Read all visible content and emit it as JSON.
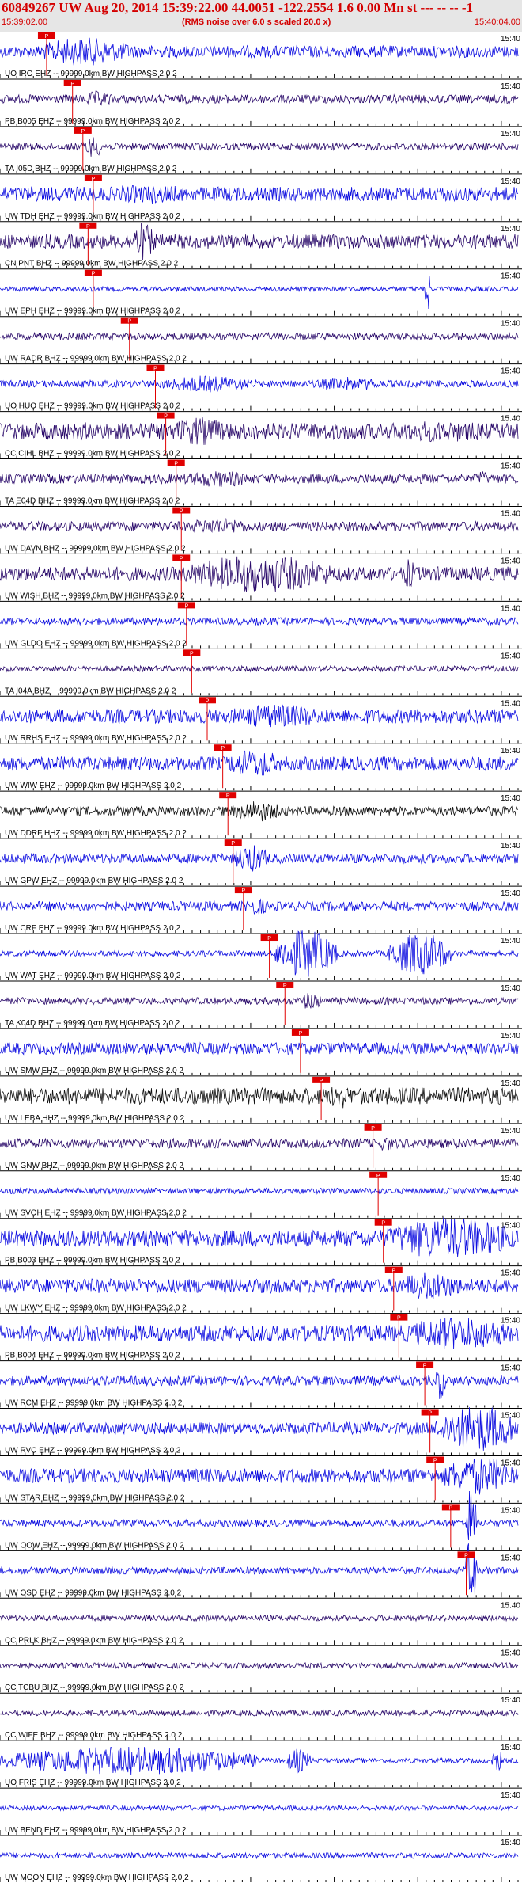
{
  "header": {
    "title": "60849267 UW Aug 20, 2014 15:39:22.00   44.0051 -122.2554  1.6 0.00 Mn st --- -- --  -1",
    "start_time": "15:39:02.00",
    "note": "(RMS noise over 6.0 s scaled 20.0 x)",
    "end_time": "15:40:04.00"
  },
  "chart_data": {
    "type": "line",
    "x_axis": {
      "start": "15:39:02.00",
      "end": "15:40:04.00",
      "unit": "time"
    },
    "tick_right_label": "15:40",
    "pick_marker_label": "P",
    "colors": {
      "blue": "#1010e0",
      "purple": "#2a0a6a",
      "black": "#111111",
      "pick": "#e00000",
      "text": "#000000"
    },
    "traces": [
      {
        "label": "UO IRO EHZ -- 99999.0km BW  HIGHPASS  2.0  2",
        "color": "blue",
        "pick": 0.09,
        "amp": 0.25,
        "bursts": [
          [
            0.07,
            0.25,
            0.6
          ],
          [
            0.15,
            0.28,
            0.4
          ]
        ]
      },
      {
        "label": "PB B005 EHZ -- 99999.0km BW  HIGHPASS  2.0  2",
        "color": "purple",
        "pick": 0.14,
        "amp": 0.18,
        "bursts": [
          [
            0.16,
            0.22,
            0.35
          ]
        ]
      },
      {
        "label": "TA I05D BHZ -- 99999.0km BW  HIGHPASS  2.0  2",
        "color": "purple",
        "pick": 0.16,
        "amp": 0.15,
        "bursts": [
          [
            0.16,
            0.2,
            0.45
          ]
        ]
      },
      {
        "label": "UW TDH EHZ -- 99999.0km BW  HIGHPASS  2.0  2",
        "color": "blue",
        "pick": 0.18,
        "amp": 0.3,
        "bursts": [
          [
            0.18,
            0.4,
            0.4
          ]
        ]
      },
      {
        "label": "CN PNT BHZ -- 99999.0km BW  HIGHPASS  2.0  2",
        "color": "purple",
        "pick": 0.17,
        "amp": 0.3,
        "bursts": [
          [
            0.25,
            0.3,
            0.8
          ]
        ]
      },
      {
        "label": "UW EPH EHZ -- 99999.0km BW  HIGHPASS  2.0  2",
        "color": "blue",
        "pick": 0.18,
        "amp": 0.1,
        "bursts": [
          [
            0.82,
            0.83,
            1.2
          ]
        ]
      },
      {
        "label": "UW RADR BHZ -- 99999.0km BW  HIGHPASS  2.0  2",
        "color": "purple",
        "pick": 0.25,
        "amp": 0.15,
        "bursts": []
      },
      {
        "label": "UO HUO EHZ -- 99999.0km BW  HIGHPASS  2.0  2",
        "color": "blue",
        "pick": 0.3,
        "amp": 0.15,
        "bursts": [
          [
            0.3,
            0.5,
            0.35
          ],
          [
            0.6,
            0.75,
            0.3
          ]
        ]
      },
      {
        "label": "CC CIHL BHZ -- 99999.0km BW  HIGHPASS  2.0  2",
        "color": "purple",
        "pick": 0.32,
        "amp": 0.35,
        "bursts": [
          [
            0.32,
            0.45,
            0.6
          ],
          [
            0.7,
            1.0,
            0.45
          ]
        ]
      },
      {
        "label": "TA E04D BHZ -- 99999.0km BW  HIGHPASS  2.0  2",
        "color": "purple",
        "pick": 0.34,
        "amp": 0.2,
        "bursts": [
          [
            0.34,
            0.5,
            0.35
          ],
          [
            0.92,
            0.94,
            0.4
          ]
        ]
      },
      {
        "label": "UW DAVN BHZ -- 99999.0km BW  HIGHPASS  2.0  2",
        "color": "purple",
        "pick": 0.35,
        "amp": 0.2,
        "bursts": [
          [
            0.35,
            0.5,
            0.35
          ]
        ]
      },
      {
        "label": "UW WISH BHZ -- 99999.0km BW  HIGHPASS  2.0  2",
        "color": "purple",
        "pick": 0.35,
        "amp": 0.3,
        "bursts": [
          [
            0.35,
            0.65,
            0.8
          ],
          [
            0.78,
            0.8,
            0.7
          ]
        ]
      },
      {
        "label": "UW GLDO EHZ -- 99999.0km BW  HIGHPASS  2.0  2",
        "color": "blue",
        "pick": 0.36,
        "amp": 0.15,
        "bursts": []
      },
      {
        "label": "TA I04A BHZ -- 99999.0km BW  HIGHPASS  2.0  2",
        "color": "purple",
        "pick": 0.37,
        "amp": 0.12,
        "bursts": []
      },
      {
        "label": "UW RRHS EHZ -- 99999.0km BW  HIGHPASS  2.0  2",
        "color": "blue",
        "pick": 0.4,
        "amp": 0.3,
        "bursts": [
          [
            0.42,
            0.65,
            0.5
          ]
        ]
      },
      {
        "label": "UW WIW EHZ -- 99999.0km BW  HIGHPASS  2.0  2",
        "color": "blue",
        "pick": 0.43,
        "amp": 0.3,
        "bursts": [
          [
            0.43,
            0.55,
            0.6
          ]
        ]
      },
      {
        "label": "UW DDRF HHZ -- 99999.0km BW  HIGHPASS  2.0  2",
        "color": "black",
        "pick": 0.44,
        "amp": 0.2,
        "bursts": [
          [
            0.44,
            0.55,
            0.45
          ]
        ]
      },
      {
        "label": "UW GPW EHZ -- 99999.0km BW  HIGHPASS  2.0  2",
        "color": "blue",
        "pick": 0.45,
        "amp": 0.2,
        "bursts": [
          [
            0.45,
            0.52,
            0.6
          ]
        ]
      },
      {
        "label": "UW CRF EHZ -- 99999.0km BW  HIGHPASS  2.0  2",
        "color": "blue",
        "pick": 0.47,
        "amp": 0.2,
        "bursts": [
          [
            0.47,
            0.52,
            0.4
          ]
        ]
      },
      {
        "label": "UW WAT EHZ -- 99999.0km BW  HIGHPASS  2.0  2",
        "color": "blue",
        "pick": 0.52,
        "amp": 0.12,
        "bursts": [
          [
            0.53,
            0.65,
            1.0
          ],
          [
            0.75,
            0.87,
            0.9
          ]
        ]
      },
      {
        "label": "TA K04D BHZ -- 99999.0km BW  HIGHPASS  2.0  2",
        "color": "purple",
        "pick": 0.55,
        "amp": 0.15,
        "bursts": [
          [
            0.58,
            0.62,
            0.4
          ]
        ]
      },
      {
        "label": "UW SMW EHZ -- 99999.0km BW  HIGHPASS  2.0  2",
        "color": "blue",
        "pick": 0.58,
        "amp": 0.25,
        "bursts": []
      },
      {
        "label": "UW LEBA HHZ -- 99999.0km BW  HIGHPASS  2.0  2",
        "color": "black",
        "pick": 0.62,
        "amp": 0.35,
        "bursts": [
          [
            0.63,
            0.68,
            0.55
          ]
        ]
      },
      {
        "label": "UW GNW BHZ -- 99999.0km BW  HIGHPASS  2.0  2",
        "color": "purple",
        "pick": 0.72,
        "amp": 0.2,
        "bursts": [
          [
            0.73,
            0.76,
            0.35
          ]
        ]
      },
      {
        "label": "UW SVOH EHZ -- 99999.0km BW  HIGHPASS  2.0  2",
        "color": "blue",
        "pick": 0.73,
        "amp": 0.12,
        "bursts": []
      },
      {
        "label": "PB B003 EHZ -- 99999.0km BW  HIGHPASS  2.0  2",
        "color": "blue",
        "pick": 0.74,
        "amp": 0.35,
        "bursts": [
          [
            0.74,
            1.0,
            0.9
          ]
        ]
      },
      {
        "label": "UW LKWY EHZ -- 99999.0km BW  HIGHPASS  2.0  2",
        "color": "blue",
        "pick": 0.76,
        "amp": 0.3,
        "bursts": [
          [
            0.76,
            0.9,
            0.6
          ]
        ]
      },
      {
        "label": "PB B004 EHZ -- 99999.0km BW  HIGHPASS  2.0  2",
        "color": "blue",
        "pick": 0.77,
        "amp": 0.35,
        "bursts": [
          [
            0.77,
            1.0,
            0.7
          ]
        ]
      },
      {
        "label": "UW RCM EHZ -- 99999.0km BW  HIGHPASS  2.0  2",
        "color": "blue",
        "pick": 0.82,
        "amp": 0.2,
        "bursts": [
          [
            0.84,
            0.86,
            0.8
          ]
        ]
      },
      {
        "label": "UW RVC EHZ -- 99999.0km BW  HIGHPASS  2.0  2",
        "color": "blue",
        "pick": 0.83,
        "amp": 0.25,
        "bursts": [
          [
            0.84,
            1.0,
            1.0
          ]
        ]
      },
      {
        "label": "UW STAR EHZ -- 99999.0km BW  HIGHPASS  2.0  2",
        "color": "blue",
        "pick": 0.84,
        "amp": 0.3,
        "bursts": [
          [
            0.85,
            1.0,
            0.8
          ]
        ]
      },
      {
        "label": "UW OOW EHZ -- 99999.0km BW  HIGHPASS  2.0  2",
        "color": "blue",
        "pick": 0.87,
        "amp": 0.15,
        "bursts": [
          [
            0.9,
            0.92,
            1.6
          ]
        ]
      },
      {
        "label": "UW OSD EHZ -- 99999.0km BW  HIGHPASS  2.0  2",
        "color": "blue",
        "pick": 0.9,
        "amp": 0.15,
        "bursts": [
          [
            0.9,
            0.92,
            1.6
          ]
        ]
      },
      {
        "label": "CC PRLK BHZ -- 99999.0km BW  HIGHPASS  2.0  2",
        "color": "purple",
        "pick": null,
        "amp": 0.12,
        "bursts": []
      },
      {
        "label": "CC TCBU BHZ -- 99999.0km BW  HIGHPASS  2.0  2",
        "color": "purple",
        "pick": null,
        "amp": 0.12,
        "bursts": []
      },
      {
        "label": "CC WIFE BHZ -- 99999.0km BW  HIGHPASS  2.0  2",
        "color": "purple",
        "pick": null,
        "amp": 0.12,
        "bursts": []
      },
      {
        "label": "UO FRIS EHZ -- 99999.0km BW  HIGHPASS  2.0  2",
        "color": "blue",
        "pick": null,
        "amp": 0.1,
        "bursts": [
          [
            0.0,
            0.5,
            0.6
          ],
          [
            0.55,
            0.6,
            0.5
          ],
          [
            0.95,
            0.97,
            0.5
          ]
        ]
      },
      {
        "label": "UW BEND EHZ -- 99999.0km BW  HIGHPASS  2.0  2",
        "color": "blue",
        "pick": null,
        "amp": 0.1,
        "bursts": []
      },
      {
        "label": "UW MOON EHZ -- 99999.0km BW  HIGHPASS  2.0  2",
        "color": "blue",
        "pick": null,
        "amp": 0.12,
        "bursts": []
      }
    ]
  }
}
